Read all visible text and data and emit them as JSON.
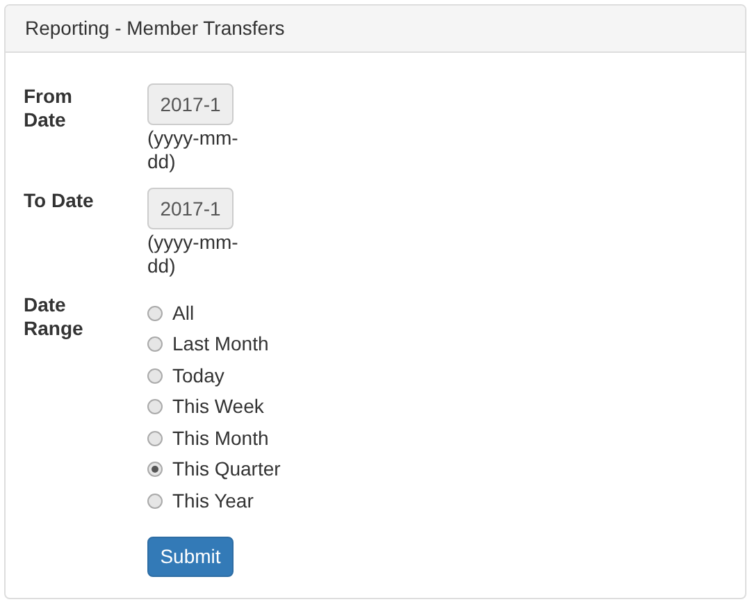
{
  "panel": {
    "title": "Reporting - Member Transfers"
  },
  "fields": [
    {
      "label": "From Date",
      "value": "2017-1",
      "disabled": true,
      "hint": "(yyyy-mm-dd)"
    },
    {
      "label": "To Date",
      "value": "2017-1",
      "disabled": true,
      "hint": "(yyyy-mm-dd)"
    }
  ],
  "date_range": {
    "label": "Date Range",
    "options": [
      {
        "label": "All",
        "selected": false
      },
      {
        "label": "Last Month",
        "selected": false
      },
      {
        "label": "Today",
        "selected": false
      },
      {
        "label": "This Week",
        "selected": false
      },
      {
        "label": "This Month",
        "selected": false
      },
      {
        "label": "This Quarter",
        "selected": true
      },
      {
        "label": "This Year",
        "selected": false
      }
    ]
  },
  "submit": "Submit"
}
